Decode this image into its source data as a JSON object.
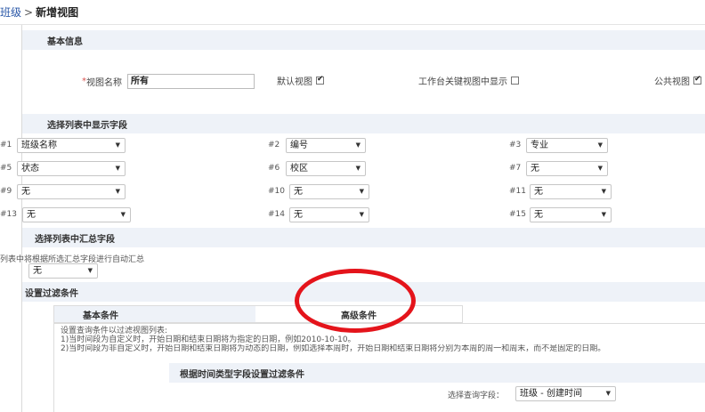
{
  "breadcrumb": {
    "parent": "班级",
    "separator": ">",
    "current": "新增视图"
  },
  "sections": {
    "basic_info": "基本信息",
    "display_fields": "选择列表中显示字段",
    "summary_fields": "选择列表中汇总字段",
    "filter": "设置过滤条件"
  },
  "basic": {
    "required_mark": "*",
    "view_name_label": "视图名称",
    "view_name_value": "所有",
    "default_view_label": "默认视图",
    "workbench_label": "工作台关键视图中显示",
    "public_view_label": "公共视图"
  },
  "fields": [
    {
      "num": "#1",
      "value": "班级名称"
    },
    {
      "num": "#2",
      "value": "编号"
    },
    {
      "num": "#3",
      "value": "专业"
    },
    {
      "num": "#5",
      "value": "状态"
    },
    {
      "num": "#6",
      "value": "校区"
    },
    {
      "num": "#7",
      "value": "无"
    },
    {
      "num": "#9",
      "value": "无"
    },
    {
      "num": "#10",
      "value": "无"
    },
    {
      "num": "#11",
      "value": "无"
    },
    {
      "num": "#13",
      "value": "无"
    },
    {
      "num": "#14",
      "value": "无"
    },
    {
      "num": "#15",
      "value": "无"
    }
  ],
  "summary": {
    "note": "列表中将根据所选汇总字段进行自动汇总",
    "value": "无"
  },
  "filter": {
    "tab_basic": "基本条件",
    "tab_advanced": "高级条件",
    "desc_title": "设置查询条件以过滤视图列表:",
    "desc_line1": "1)当时间段为自定义时，开始日期和结束日期将为指定的日期，例如2010-10-10。",
    "desc_line2": "2)当时间段为非自定义时，开始日期和结束日期将为动态的日期，例如选择本周时，开始日期和结束日期将分别为本周的周一和周末，而不是固定的日期。",
    "time_section": "根据时间类型字段设置过滤条件",
    "query_label": "选择查询字段：",
    "query_value": "班级 - 创建时间"
  },
  "icons": {
    "dropdown": "▼",
    "check": "✔"
  },
  "colors": {
    "annotation": "#e4141b",
    "section_bg": "#eef2f8",
    "link": "#2b58a8"
  }
}
